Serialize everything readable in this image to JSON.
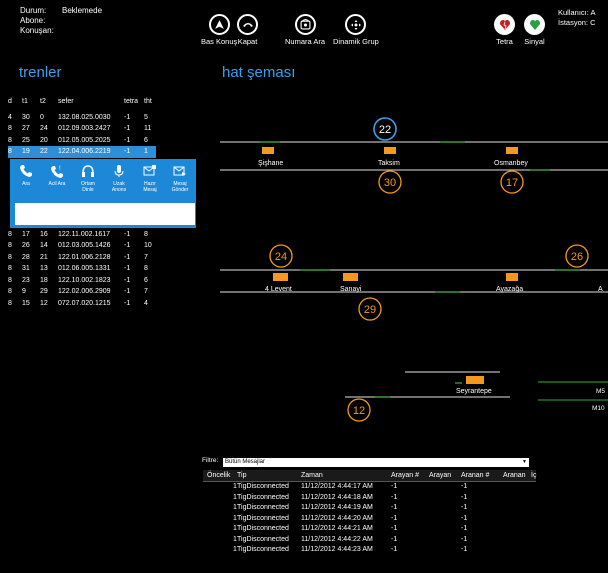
{
  "status": {
    "durum_label": "Durum:",
    "durum_value": "Beklemede",
    "abone_label": "Abone:",
    "konusan_label": "Konuşan:"
  },
  "toolbar": {
    "bas_konus": "Bas Konuş",
    "kapat": "Kapat",
    "numara_ara": "Numara Ara",
    "dinamik_grup": "Dinamik Grup",
    "tetra": "Tetra",
    "sinyal": "Sinyal"
  },
  "user": {
    "kullanici_label": "Kullanıcı:",
    "kullanici_value": "A",
    "istasyon_label": "İstasyon:",
    "istasyon_value": "C"
  },
  "trains_title": "trenler",
  "diagram_title": "hat şeması",
  "trains": {
    "headers": [
      "d",
      "t1",
      "t2",
      "sefer",
      "tetra",
      "tht"
    ],
    "rows_top": [
      [
        "4",
        "30",
        "0",
        "132.08.025.0030",
        "-1",
        "5"
      ],
      [
        "8",
        "27",
        "24",
        "012.09.003.2427",
        "-1",
        "11"
      ],
      [
        "8",
        "25",
        "20",
        "012.05.005.2025",
        "-1",
        "6"
      ]
    ],
    "selected": [
      "8",
      "19",
      "22",
      "122.04.006.2219",
      "-1",
      "1"
    ],
    "rows_bottom": [
      [
        "8",
        "17",
        "16",
        "122.11.002.1617",
        "-1",
        "8"
      ],
      [
        "8",
        "26",
        "14",
        "012.03.005.1426",
        "-1",
        "10"
      ],
      [
        "8",
        "28",
        "21",
        "122.01.006.2128",
        "-1",
        "7"
      ],
      [
        "8",
        "31",
        "13",
        "012.06.005.1331",
        "-1",
        "8"
      ],
      [
        "8",
        "23",
        "18",
        "122.10.002.1823",
        "-1",
        "6"
      ],
      [
        "8",
        "9",
        "29",
        "122.02.006.2909",
        "-1",
        "7"
      ],
      [
        "8",
        "15",
        "12",
        "072.07.020.1215",
        "-1",
        "4"
      ]
    ]
  },
  "actions": {
    "ara": "Ara",
    "acil_ara": "Acil Ara",
    "ortam_dinle": "Ortam Dinle",
    "uzak_anons": "Uzak Anons",
    "hazir_mesaj": "Hazır Mesaj",
    "mesaj_gonder": "Mesaj Gönder"
  },
  "stations": {
    "sishane": "Şişhane",
    "taksim": "Taksim",
    "osmanbey": "Osmanbey",
    "levent4": "4 Levent",
    "sanayi": "Sanayi",
    "ayazaga": "Ayazağa",
    "seyrantepe": "Seyrantepe",
    "m5": "M5",
    "m10": "M10"
  },
  "train_badges": {
    "b22": "22",
    "b30": "30",
    "b17": "17",
    "b24": "24",
    "b26": "26",
    "b29": "29",
    "b12": "12"
  },
  "colors": {
    "accent": "#3aa0e8",
    "train": "#f39a1e",
    "track": "#b5b5b5",
    "signal": "#2f8a2f"
  },
  "log": {
    "filter_label": "Filtre:",
    "filter_value": "Bütün Mesajlar",
    "headers": [
      "Öncelik",
      "Tip",
      "Zaman",
      "Arayan #",
      "Arayan",
      "Aranan #",
      "Aranan",
      "İç"
    ],
    "rows": [
      [
        "1",
        "TigDisconnected",
        "11/12/2012 4:44:17 AM",
        "-1",
        "",
        "-1",
        "",
        ""
      ],
      [
        "1",
        "TigDisconnected",
        "11/12/2012 4:44:18 AM",
        "-1",
        "",
        "-1",
        "",
        ""
      ],
      [
        "1",
        "TigDisconnected",
        "11/12/2012 4:44:19 AM",
        "-1",
        "",
        "-1",
        "",
        ""
      ],
      [
        "1",
        "TigDisconnected",
        "11/12/2012 4:44:20 AM",
        "-1",
        "",
        "-1",
        "",
        ""
      ],
      [
        "1",
        "TigDisconnected",
        "11/12/2012 4:44:21 AM",
        "-1",
        "",
        "-1",
        "",
        ""
      ],
      [
        "1",
        "TigDisconnected",
        "11/12/2012 4:44:22 AM",
        "-1",
        "",
        "-1",
        "",
        ""
      ],
      [
        "1",
        "TigDisconnected",
        "11/12/2012 4:44:23 AM",
        "-1",
        "",
        "-1",
        "",
        ""
      ]
    ]
  }
}
